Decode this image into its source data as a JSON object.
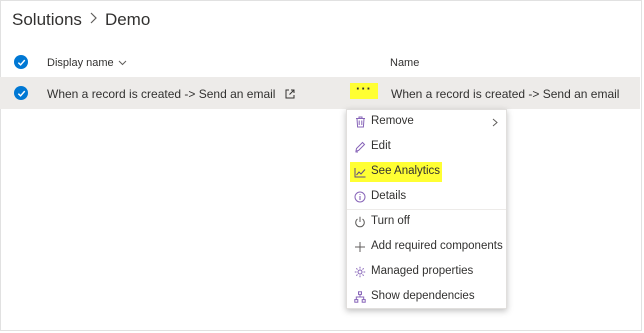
{
  "breadcrumb": {
    "root": "Solutions",
    "current": "Demo"
  },
  "table": {
    "columns": {
      "display_name": "Display name",
      "name": "Name"
    },
    "rows": [
      {
        "display_name": "When a record is created -> Send an email",
        "name": "When a record is created -> Send an email",
        "selected": true
      }
    ]
  },
  "more_button": {
    "label": "···"
  },
  "context_menu": {
    "items": [
      {
        "label": "Remove",
        "icon": "trash-icon",
        "has_submenu": true
      },
      {
        "label": "Edit",
        "icon": "pencil-icon"
      },
      {
        "label": "See Analytics",
        "icon": "chart-icon",
        "highlighted": true
      },
      {
        "label": "Details",
        "icon": "info-icon"
      },
      {
        "label": "Turn off",
        "icon": "power-icon"
      },
      {
        "label": "Add required components",
        "icon": "plus-icon"
      },
      {
        "label": "Managed properties",
        "icon": "gear-icon"
      },
      {
        "label": "Show dependencies",
        "icon": "hierarchy-icon"
      }
    ]
  },
  "colors": {
    "accent": "#0078d4",
    "highlight": "#ffff33",
    "menu_icon": "#8764b8",
    "row_bg": "#edebe9"
  }
}
